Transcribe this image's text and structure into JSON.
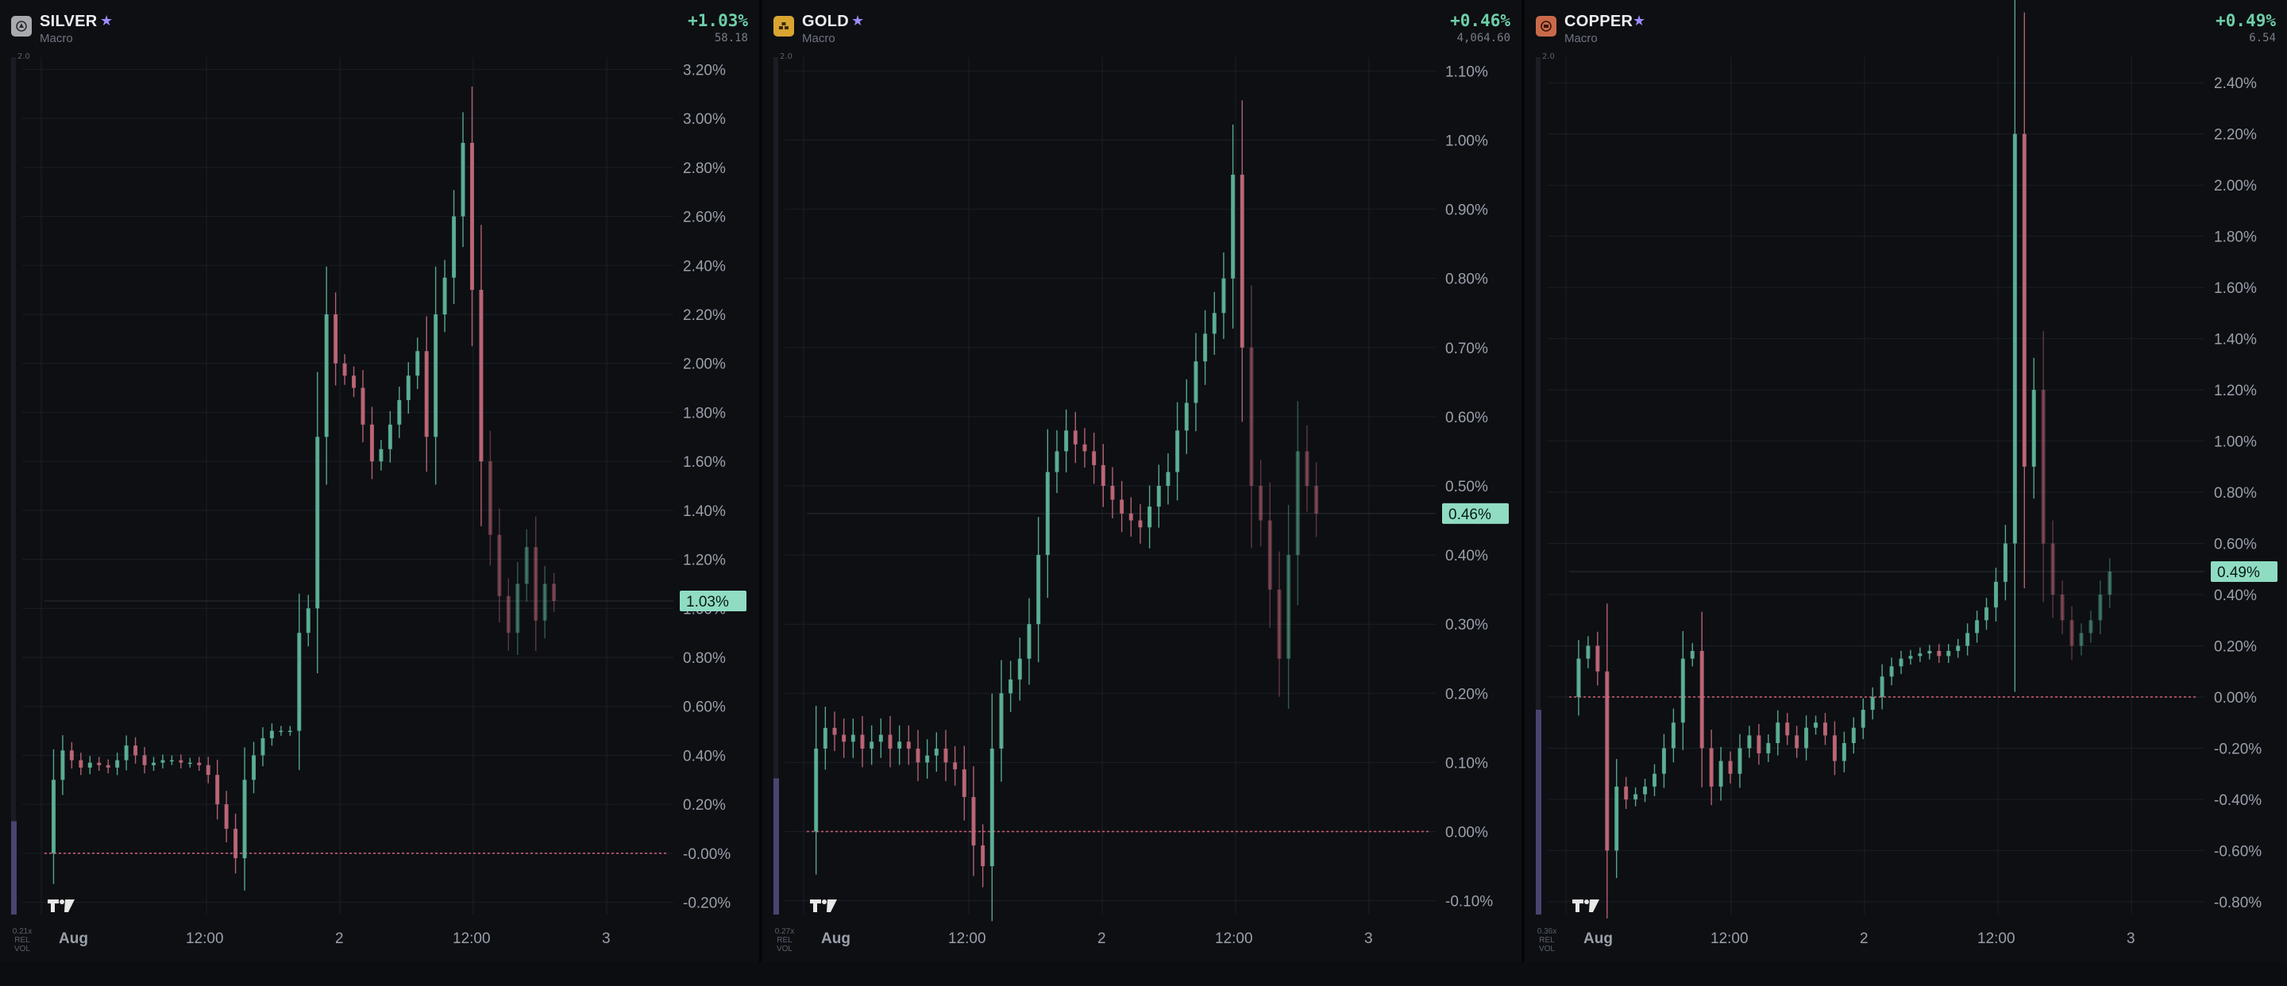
{
  "colors": {
    "background": "#0d0f13",
    "grid": "#1b1f26",
    "up": "#5fb79a",
    "down": "#c46a7b",
    "baseline": "#c75a6e",
    "badge": "#8fdcc3",
    "positive_text": "#6ecfa8",
    "volume_bar": "#4a4470"
  },
  "panels": [
    {
      "name": "SILVER",
      "category": "Macro",
      "change": "+1.03%",
      "price": "58.18",
      "icon": "silver-coin-icon",
      "icon_color": "#a9aab0",
      "vol_top": "2.0",
      "vol_note": [
        "0.21x",
        "REL",
        "VOL"
      ],
      "vol_level": 0.12,
      "x_labels": [
        "Aug",
        "12:00",
        "2",
        "12:00",
        "3"
      ],
      "chart_data": {
        "type": "candlestick",
        "x": [
          "Aug",
          "12:00",
          "2",
          "12:00",
          "3"
        ],
        "ylabel": "",
        "ylim": [
          -0.25,
          3.25
        ],
        "yticks": [
          "3.20%",
          "3.00%",
          "2.80%",
          "2.60%",
          "2.40%",
          "2.20%",
          "2.00%",
          "1.80%",
          "1.60%",
          "1.40%",
          "1.20%",
          "1.00%",
          "0.80%",
          "0.60%",
          "0.40%",
          "0.20%",
          "-0.00%",
          "-0.20%"
        ],
        "ytick_values": [
          3.2,
          3.0,
          2.8,
          2.6,
          2.4,
          2.2,
          2.0,
          1.8,
          1.6,
          1.4,
          1.2,
          1.0,
          0.8,
          0.6,
          0.4,
          0.2,
          0.0,
          -0.2
        ],
        "current": 1.03,
        "current_label": "1.03%",
        "baseline": 0.0,
        "series": [
          {
            "values": [
              0.0,
              0.3,
              0.42,
              0.38,
              0.35,
              0.37,
              0.36,
              0.35,
              0.38,
              0.44,
              0.4,
              0.36,
              0.37,
              0.38,
              0.38,
              0.37,
              0.37,
              0.36,
              0.32,
              0.2,
              0.1,
              -0.02,
              0.3,
              0.4,
              0.47,
              0.5,
              0.5,
              0.5,
              0.9,
              1.0,
              1.7,
              2.2,
              2.0,
              1.95,
              1.9,
              1.75,
              1.6,
              1.65,
              1.75,
              1.85,
              1.95,
              2.05,
              1.7,
              2.2,
              2.35,
              2.6,
              2.9,
              2.3,
              1.6,
              1.3,
              1.05,
              0.9,
              1.1,
              1.25,
              0.95,
              1.1,
              1.03
            ]
          }
        ]
      }
    },
    {
      "name": "GOLD",
      "category": "Macro",
      "change": "+0.46%",
      "price": "4,064.60",
      "icon": "gold-bars-icon",
      "icon_color": "#d9a531",
      "vol_top": "2.0",
      "vol_note": [
        "0.27x",
        "REL",
        "VOL"
      ],
      "vol_level": 0.17,
      "x_labels": [
        "Aug",
        "12:00",
        "2",
        "12:00",
        "3"
      ],
      "chart_data": {
        "type": "candlestick",
        "x": [
          "Aug",
          "12:00",
          "2",
          "12:00",
          "3"
        ],
        "ylabel": "",
        "ylim": [
          -0.12,
          1.12
        ],
        "yticks": [
          "1.10%",
          "1.00%",
          "0.90%",
          "0.80%",
          "0.70%",
          "0.60%",
          "0.50%",
          "0.40%",
          "0.30%",
          "0.20%",
          "0.10%",
          "0.00%",
          "-0.10%"
        ],
        "ytick_values": [
          1.1,
          1.0,
          0.9,
          0.8,
          0.7,
          0.6,
          0.5,
          0.4,
          0.3,
          0.2,
          0.1,
          0.0,
          -0.1
        ],
        "current": 0.46,
        "current_label": "0.46%",
        "baseline": 0.0,
        "series": [
          {
            "values": [
              0.0,
              0.12,
              0.15,
              0.14,
              0.13,
              0.14,
              0.12,
              0.13,
              0.14,
              0.12,
              0.13,
              0.12,
              0.1,
              0.11,
              0.12,
              0.1,
              0.09,
              0.05,
              -0.02,
              -0.05,
              0.12,
              0.2,
              0.22,
              0.25,
              0.3,
              0.4,
              0.52,
              0.55,
              0.58,
              0.56,
              0.55,
              0.53,
              0.5,
              0.48,
              0.46,
              0.45,
              0.44,
              0.47,
              0.5,
              0.52,
              0.58,
              0.62,
              0.68,
              0.72,
              0.75,
              0.8,
              0.95,
              0.7,
              0.5,
              0.45,
              0.35,
              0.25,
              0.4,
              0.55,
              0.5,
              0.46
            ]
          }
        ]
      }
    },
    {
      "name": "COPPER",
      "category": "Macro",
      "change": "+0.49%",
      "price": "6.54",
      "icon": "copper-coin-icon",
      "icon_color": "#c86a4a",
      "vol_top": "2.0",
      "vol_note": [
        "0.36x",
        "REL",
        "VOL"
      ],
      "vol_level": 0.25,
      "x_labels": [
        "Aug",
        "12:00",
        "2",
        "12:00",
        "3"
      ],
      "chart_data": {
        "type": "candlestick",
        "x": [
          "Aug",
          "12:00",
          "2",
          "12:00",
          "3"
        ],
        "ylabel": "",
        "ylim": [
          -0.85,
          2.5
        ],
        "yticks": [
          "2.40%",
          "2.20%",
          "2.00%",
          "1.80%",
          "1.60%",
          "1.40%",
          "1.20%",
          "1.00%",
          "0.80%",
          "0.60%",
          "0.40%",
          "0.20%",
          "0.00%",
          "-0.20%",
          "-0.40%",
          "-0.60%",
          "-0.80%"
        ],
        "ytick_values": [
          2.4,
          2.2,
          2.0,
          1.8,
          1.6,
          1.4,
          1.2,
          1.0,
          0.8,
          0.6,
          0.4,
          0.2,
          0.0,
          -0.2,
          -0.4,
          -0.6,
          -0.8
        ],
        "current": 0.49,
        "current_label": "0.49%",
        "baseline": 0.0,
        "series": [
          {
            "values": [
              0.0,
              0.15,
              0.2,
              0.1,
              -0.6,
              -0.35,
              -0.4,
              -0.38,
              -0.35,
              -0.3,
              -0.2,
              -0.1,
              0.15,
              0.18,
              -0.2,
              -0.35,
              -0.25,
              -0.3,
              -0.2,
              -0.15,
              -0.22,
              -0.18,
              -0.1,
              -0.15,
              -0.2,
              -0.12,
              -0.1,
              -0.15,
              -0.25,
              -0.18,
              -0.12,
              -0.05,
              0.0,
              0.08,
              0.12,
              0.15,
              0.16,
              0.17,
              0.18,
              0.16,
              0.18,
              0.2,
              0.25,
              0.3,
              0.35,
              0.45,
              0.6,
              2.2,
              0.9,
              1.2,
              0.6,
              0.4,
              0.3,
              0.2,
              0.25,
              0.3,
              0.4,
              0.49
            ]
          }
        ]
      }
    }
  ]
}
